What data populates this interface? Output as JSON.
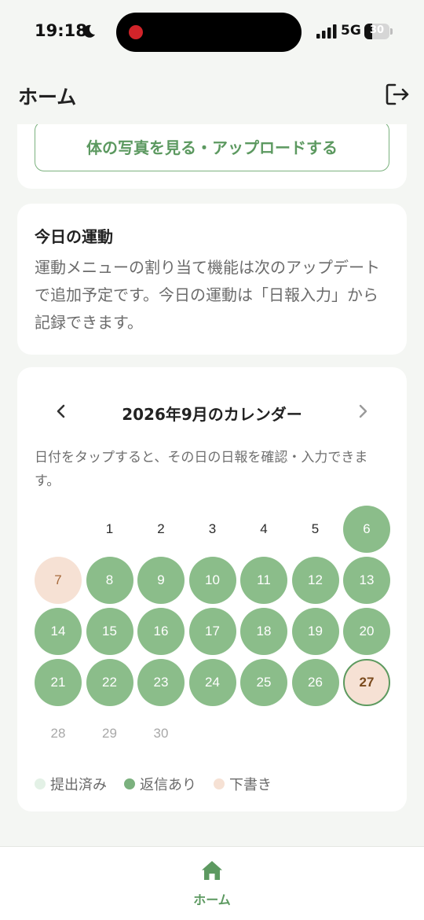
{
  "status_bar": {
    "time": "19:18",
    "network": "5G",
    "battery": 30
  },
  "header": {
    "title": "ホーム",
    "logout_icon": "logout-icon"
  },
  "photo_card": {
    "button_label": "体の写真を見る・アップロードする"
  },
  "exercise_card": {
    "title": "今日の運動",
    "body": "運動メニューの割り当て機能は次のアップデートで追加予定です。今日の運動は「日報入力」から記録できます。"
  },
  "calendar": {
    "title": "2026年9月のカレンダー",
    "hint": "日付をタップすると、その日の日報を確認・入力できます。",
    "first_weekday_index": 1,
    "today": 27,
    "days": [
      {
        "label": "1",
        "state": "plain"
      },
      {
        "label": "2",
        "state": "plain"
      },
      {
        "label": "3",
        "state": "plain"
      },
      {
        "label": "4",
        "state": "plain"
      },
      {
        "label": "5",
        "state": "plain"
      },
      {
        "label": "6",
        "state": "replied"
      },
      {
        "label": "7",
        "state": "draft"
      },
      {
        "label": "8",
        "state": "replied"
      },
      {
        "label": "9",
        "state": "replied"
      },
      {
        "label": "10",
        "state": "replied"
      },
      {
        "label": "11",
        "state": "replied"
      },
      {
        "label": "12",
        "state": "replied"
      },
      {
        "label": "13",
        "state": "replied"
      },
      {
        "label": "14",
        "state": "replied"
      },
      {
        "label": "15",
        "state": "replied"
      },
      {
        "label": "16",
        "state": "replied"
      },
      {
        "label": "17",
        "state": "replied"
      },
      {
        "label": "18",
        "state": "replied"
      },
      {
        "label": "19",
        "state": "replied"
      },
      {
        "label": "20",
        "state": "replied"
      },
      {
        "label": "21",
        "state": "replied"
      },
      {
        "label": "22",
        "state": "replied"
      },
      {
        "label": "23",
        "state": "replied"
      },
      {
        "label": "24",
        "state": "replied"
      },
      {
        "label": "25",
        "state": "replied"
      },
      {
        "label": "26",
        "state": "replied"
      },
      {
        "label": "27",
        "state": "draft"
      },
      {
        "label": "28",
        "state": "future"
      },
      {
        "label": "29",
        "state": "future"
      },
      {
        "label": "30",
        "state": "future"
      }
    ],
    "legend": [
      {
        "label": "提出済み",
        "color": "#e3f1e6"
      },
      {
        "label": "返信あり",
        "color": "#7bb17e"
      },
      {
        "label": "下書き",
        "color": "#f6e1d4"
      }
    ]
  },
  "colors": {
    "accent": "#5c9960",
    "replied": "#8bbd8a",
    "draft": "#f6e1d4"
  },
  "bottom_nav": {
    "home_label": "ホーム",
    "home_icon": "home-icon"
  }
}
